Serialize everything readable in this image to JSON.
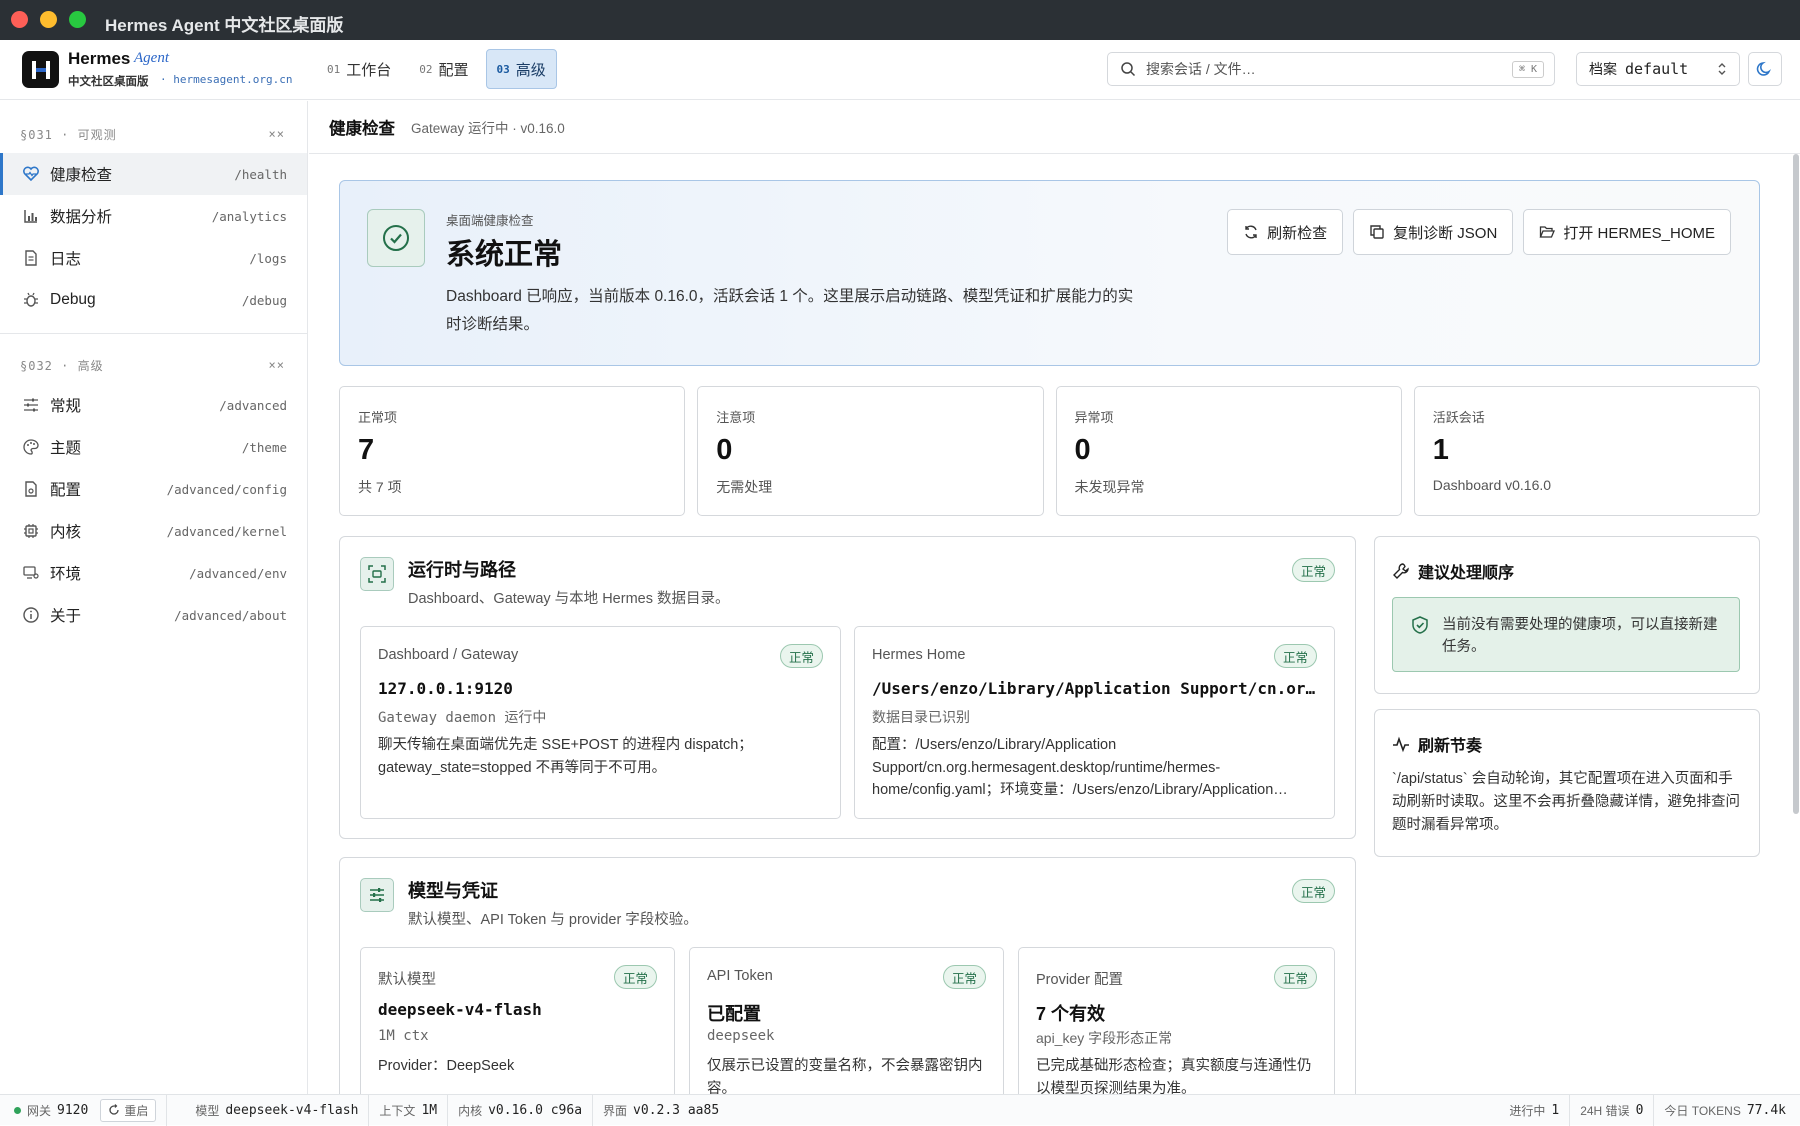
{
  "window": {
    "title": "Hermes Agent 中文社区桌面版"
  },
  "brand": {
    "name": "Hermes",
    "name2": "Agent",
    "subtitle": "中文社区桌面版",
    "url": "· hermesagent.org.cn"
  },
  "tabs": [
    {
      "num": "01",
      "label": "工作台"
    },
    {
      "num": "02",
      "label": "配置"
    },
    {
      "num": "03",
      "label": "高级"
    }
  ],
  "search": {
    "placeholder": "搜索会话 / 文件…",
    "shortcut": "⌘ K"
  },
  "profile": {
    "label": "档案",
    "value": "default"
  },
  "sidebar": {
    "section1": {
      "title": "§031 · 可观测",
      "toggle": "××"
    },
    "section1_items": [
      {
        "label": "健康检查",
        "path": "/health"
      },
      {
        "label": "数据分析",
        "path": "/analytics"
      },
      {
        "label": "日志",
        "path": "/logs"
      },
      {
        "label": "Debug",
        "path": "/debug"
      }
    ],
    "section2": {
      "title": "§032 · 高级",
      "toggle": "××"
    },
    "section2_items": [
      {
        "label": "常规",
        "path": "/advanced"
      },
      {
        "label": "主题",
        "path": "/theme"
      },
      {
        "label": "配置",
        "path": "/advanced/config"
      },
      {
        "label": "内核",
        "path": "/advanced/kernel"
      },
      {
        "label": "环境",
        "path": "/advanced/env"
      },
      {
        "label": "关于",
        "path": "/advanced/about"
      }
    ]
  },
  "page": {
    "title": "健康检查",
    "subtitle": "Gateway 运行中 · v0.16.0"
  },
  "hero": {
    "label": "桌面端健康检查",
    "title": "系统正常",
    "desc": "Dashboard 已响应，当前版本 0.16.0，活跃会话 1 个。这里展示启动链路、模型凭证和扩展能力的实时诊断结果。",
    "buttons": [
      "刷新检查",
      "复制诊断 JSON",
      "打开 HERMES_HOME"
    ]
  },
  "stats": [
    {
      "label": "正常项",
      "value": "7",
      "desc": "共 7 项"
    },
    {
      "label": "注意项",
      "value": "0",
      "desc": "无需处理"
    },
    {
      "label": "异常项",
      "value": "0",
      "desc": "未发现异常"
    },
    {
      "label": "活跃会话",
      "value": "1",
      "desc": "Dashboard v0.16.0"
    }
  ],
  "runtime": {
    "title": "运行时与路径",
    "subtitle": "Dashboard、Gateway 与本地 Hermes 数据目录。",
    "badge": "正常",
    "items": [
      {
        "label": "Dashboard / Gateway",
        "value": "127.0.0.1:9120",
        "meta": "Gateway daemon 运行中",
        "desc": "聊天传输在桌面端优先走 SSE+POST 的进程内 dispatch；gateway_state=stopped 不再等同于不可用。",
        "badge": "正常"
      },
      {
        "label": "Hermes Home",
        "value": "/Users/enzo/Library/Application Support/cn.org…",
        "meta": "数据目录已识别",
        "desc": "配置：/Users/enzo/Library/Application Support/cn.org.hermesagent.desktop/runtime/hermes-home/config.yaml；环境变量：/Users/enzo/Library/Application…",
        "badge": "正常"
      }
    ]
  },
  "model": {
    "title": "模型与凭证",
    "subtitle": "默认模型、API Token 与 provider 字段校验。",
    "badge": "正常",
    "items": [
      {
        "label": "默认模型",
        "value": "deepseek-v4-flash",
        "meta": "1M ctx",
        "desc": "Provider：DeepSeek",
        "badge": "正常"
      },
      {
        "label": "API Token",
        "value": "已配置",
        "meta": "deepseek",
        "desc": "仅展示已设置的变量名称，不会暴露密钥内容。",
        "badge": "正常"
      },
      {
        "label": "Provider 配置",
        "value": "7 个有效",
        "meta": "api_key 字段形态正常",
        "desc": "已完成基础形态检查；真实额度与连通性仍以模型页探测结果为准。",
        "badge": "正常"
      }
    ]
  },
  "advice": {
    "title": "建议处理顺序",
    "text": "当前没有需要处理的健康项，可以直接新建任务。"
  },
  "refresh": {
    "title": "刷新节奏",
    "text": "`/api/status` 会自动轮询，其它配置项在进入页面和手动刷新时读取。这里不会再折叠隐藏详情，避免排查问题时漏看异常项。"
  },
  "statusbar": {
    "gateway_label": "网关",
    "gateway_value": "9120",
    "restart": "重启",
    "model_label": "模型",
    "model_value": "deepseek-v4-flash",
    "ctx_label": "上下文",
    "ctx_value": "1M",
    "kernel_label": "内核",
    "kernel_value": "v0.16.0 c96a",
    "ui_label": "界面",
    "ui_value": "v0.2.3 aa85",
    "running_label": "进行中",
    "running_value": "1",
    "errors_label": "24H 错误",
    "errors_value": "0",
    "tokens_label": "今日 TOKENS",
    "tokens_value": "77.4k"
  },
  "colors": {
    "accent": "#2e77c9",
    "ok": "#24704a",
    "titlebar": "#2b3035"
  }
}
